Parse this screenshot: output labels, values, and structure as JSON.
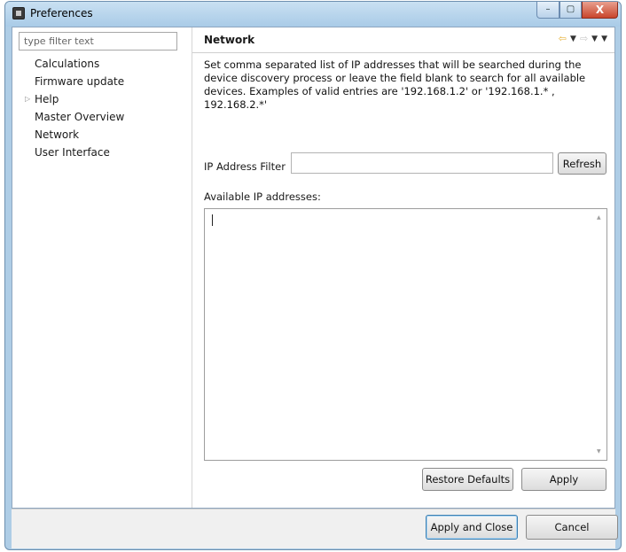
{
  "window": {
    "title": "Preferences",
    "controls": {
      "minimize": "–",
      "maximize": "▢",
      "close": "X"
    }
  },
  "sidebar": {
    "filter_placeholder": "type filter text",
    "items": [
      {
        "label": "Calculations",
        "expandable": false
      },
      {
        "label": "Firmware update",
        "expandable": false
      },
      {
        "label": "Help",
        "expandable": true,
        "arrow": "▷"
      },
      {
        "label": "Master Overview",
        "expandable": false
      },
      {
        "label": "Network",
        "expandable": false,
        "selected": true
      },
      {
        "label": "User Interface",
        "expandable": false
      }
    ]
  },
  "panel": {
    "title": "Network",
    "nav": {
      "back": "⇦",
      "forward": "⇨",
      "caret": "▼"
    },
    "description": "Set comma separated list of IP addresses that will be searched during the device discovery process or leave the field blank to search for all available devices. Examples of valid entries are '192.168.1.2' or '192.168.1.* , 192.168.2.*'",
    "ip_filter_label": "IP Address Filter",
    "ip_filter_value": "",
    "refresh_label": "Refresh",
    "available_label": "Available IP addresses:",
    "available_value": "",
    "restore_defaults_label": "Restore Defaults",
    "apply_label": "Apply"
  },
  "footer": {
    "apply_close_label": "Apply and Close",
    "cancel_label": "Cancel"
  },
  "colors": {
    "titlebar": "#aecde6",
    "close_button": "#c9452c",
    "default_button_border": "#3c7fb1"
  }
}
